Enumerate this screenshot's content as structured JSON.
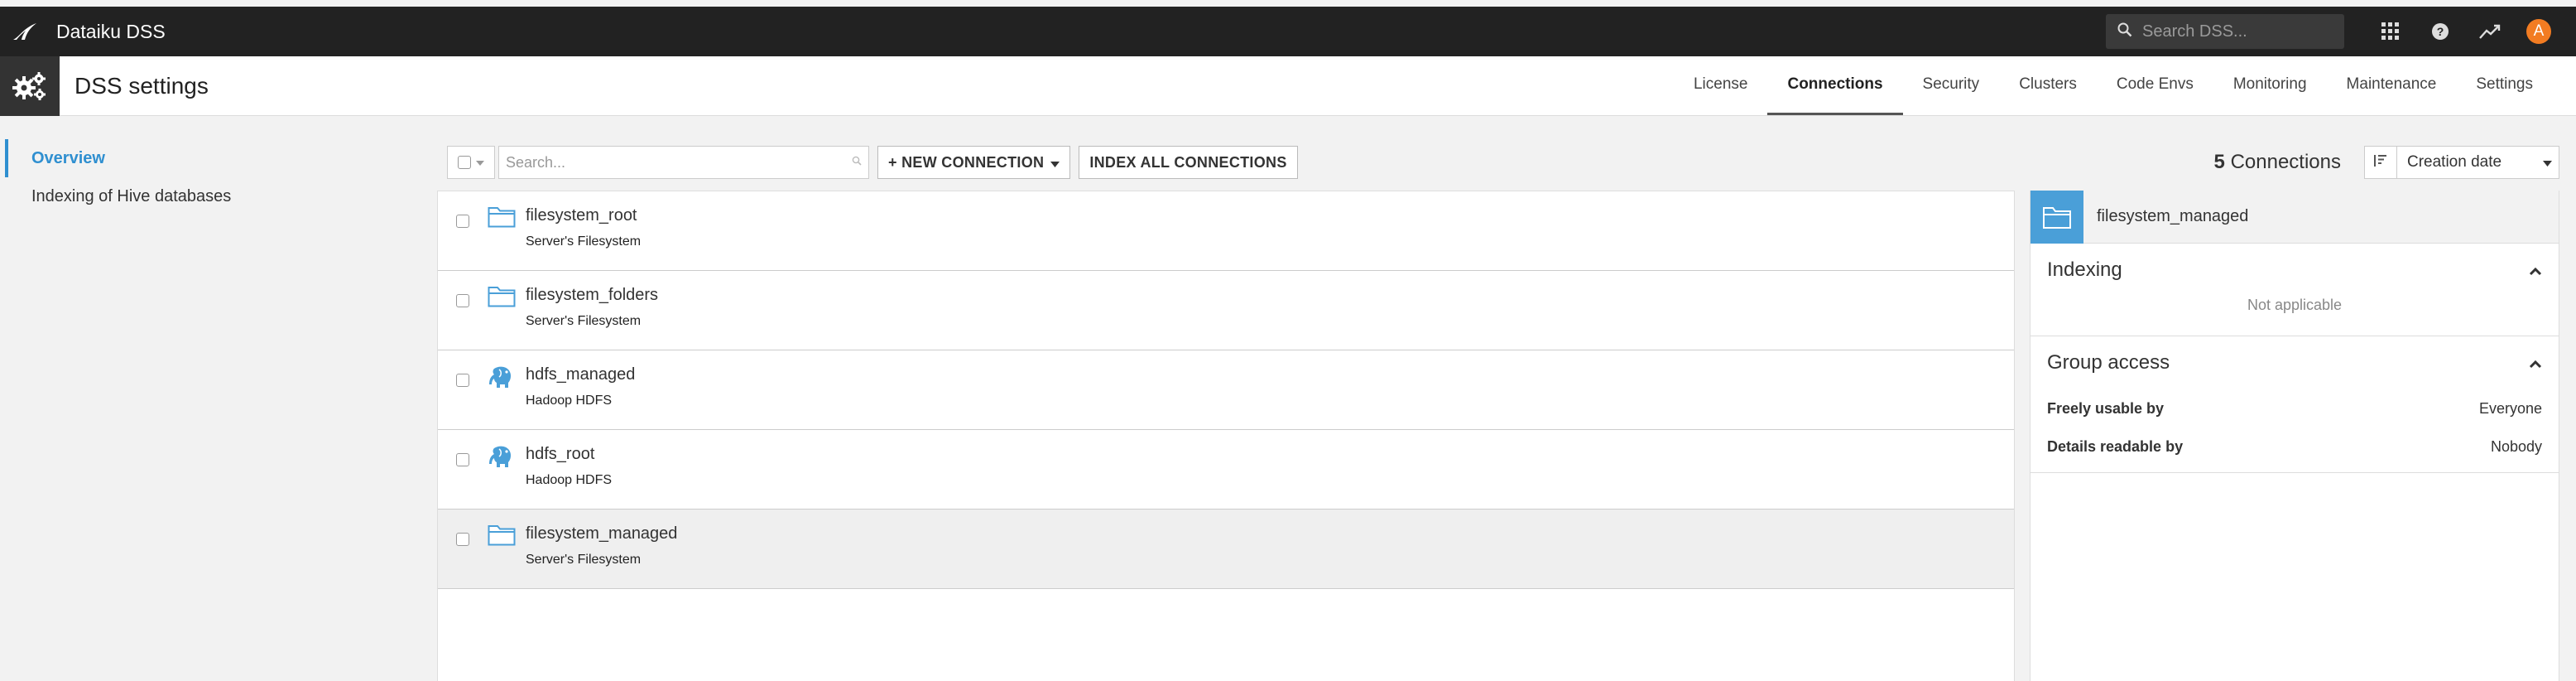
{
  "topbar": {
    "app_title": "Dataiku DSS",
    "search_placeholder": "Search DSS...",
    "avatar_initial": "A",
    "avatar_color": "#f27c22"
  },
  "header": {
    "page_title": "DSS settings",
    "tabs": [
      {
        "label": "License",
        "active": false
      },
      {
        "label": "Connections",
        "active": true
      },
      {
        "label": "Security",
        "active": false
      },
      {
        "label": "Clusters",
        "active": false
      },
      {
        "label": "Code Envs",
        "active": false
      },
      {
        "label": "Monitoring",
        "active": false
      },
      {
        "label": "Maintenance",
        "active": false
      },
      {
        "label": "Settings",
        "active": false
      }
    ]
  },
  "sidebar": {
    "items": [
      {
        "label": "Overview",
        "active": true
      },
      {
        "label": "Indexing of Hive databases",
        "active": false
      }
    ]
  },
  "toolbar": {
    "search_placeholder": "Search...",
    "new_connection_label": "+ NEW CONNECTION",
    "index_all_label": "INDEX ALL CONNECTIONS",
    "count_value": "5",
    "count_label": "Connections",
    "sort_value": "Creation date"
  },
  "connections": [
    {
      "name": "filesystem_root",
      "type": "Server's Filesystem",
      "icon": "folder-icon",
      "selected": false
    },
    {
      "name": "filesystem_folders",
      "type": "Server's Filesystem",
      "icon": "folder-icon",
      "selected": false
    },
    {
      "name": "hdfs_managed",
      "type": "Hadoop HDFS",
      "icon": "hadoop-elephant-icon",
      "selected": false
    },
    {
      "name": "hdfs_root",
      "type": "Hadoop HDFS",
      "icon": "hadoop-elephant-icon",
      "selected": false
    },
    {
      "name": "filesystem_managed",
      "type": "Server's Filesystem",
      "icon": "folder-icon",
      "selected": true
    }
  ],
  "details": {
    "name": "filesystem_managed",
    "indexing": {
      "title": "Indexing",
      "status": "Not applicable"
    },
    "group_access": {
      "title": "Group access",
      "freely_usable_label": "Freely usable by",
      "freely_usable_value": "Everyone",
      "details_readable_label": "Details readable by",
      "details_readable_value": "Nobody"
    }
  },
  "colors": {
    "accent": "#2f8fd0",
    "icon_blue": "#4a9fd8",
    "topbar": "#222222"
  }
}
